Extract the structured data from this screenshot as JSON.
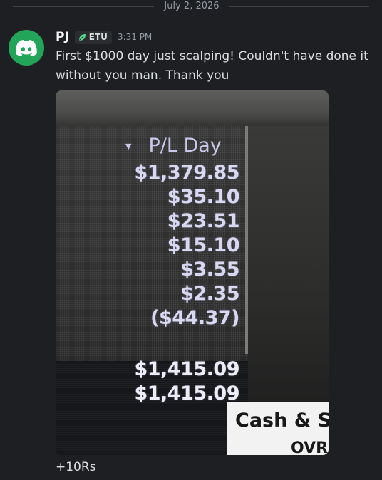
{
  "date_divider": "July 2, 2026",
  "message": {
    "username": "PJ",
    "role_tag": "ETU",
    "timestamp": "3:31 PM",
    "text": "First $1000 day just scalping! Couldn't have done it without you man. Thank you",
    "avatar_icon": "discord-logo-icon",
    "avatar_color": "#23a559"
  },
  "attachment": {
    "column_header": "P/L Day",
    "values": [
      "$1,379.85",
      "$35.10",
      "$23.51",
      "$15.10",
      "$3.55",
      "$2.35",
      "($44.37)"
    ],
    "totals": [
      "$1,415.09",
      "$1,415.09"
    ],
    "panel_label_1": "Cash & Sw",
    "panel_label_2": "OVR"
  },
  "reply": "+10Rs"
}
